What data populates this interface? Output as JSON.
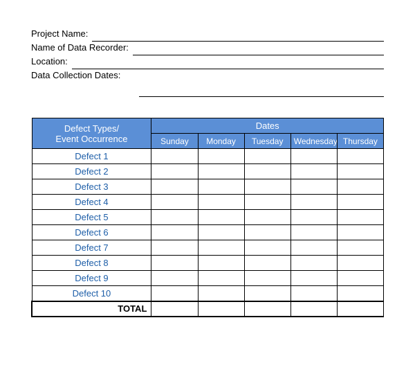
{
  "info": {
    "project_name_label": "Project Name:",
    "recorder_label": "Name of Data Recorder:",
    "location_label": "Location:",
    "dates_label": "Data Collection Dates:"
  },
  "table": {
    "defect_header_line1": "Defect Types/",
    "defect_header_line2": "Event Occurrence",
    "dates_header": "Dates",
    "days": [
      "Sunday",
      "Monday",
      "Tuesday",
      "Wednesday",
      "Thursday"
    ],
    "defects": [
      "Defect 1",
      "Defect 2",
      "Defect 3",
      "Defect 4",
      "Defect 5",
      "Defect 6",
      "Defect 7",
      "Defect 8",
      "Defect 9",
      "Defect 10"
    ],
    "total_label": "TOTAL"
  }
}
